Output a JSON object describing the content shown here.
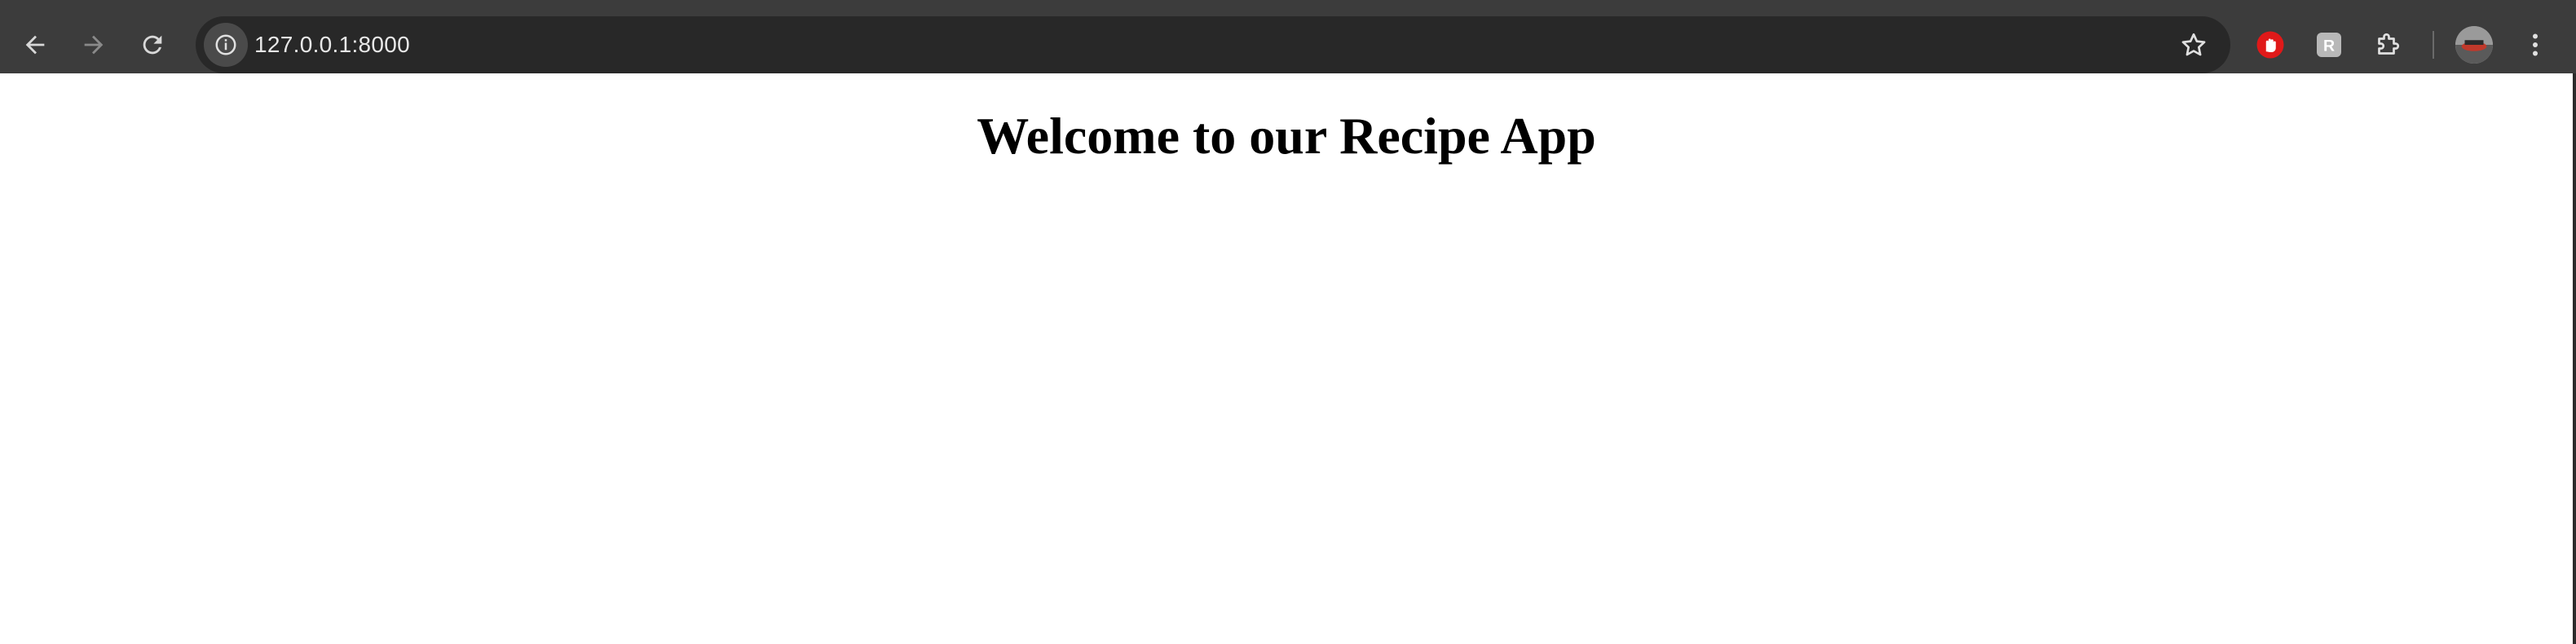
{
  "browser": {
    "url": "127.0.0.1:8000",
    "toolbar_color": "#3c3c3c",
    "omnibox_color": "#282828",
    "icons": {
      "back": "back-arrow-icon",
      "forward": "forward-arrow-icon",
      "reload": "reload-icon",
      "site_info": "info-icon",
      "bookmark": "star-icon",
      "extension_1": "hand-stop-icon",
      "extension_2": "r-letter-icon",
      "extensions_menu": "puzzle-icon",
      "profile": "avatar",
      "menu": "kebab-menu-icon"
    }
  },
  "page": {
    "heading": "Welcome to our Recipe App"
  }
}
